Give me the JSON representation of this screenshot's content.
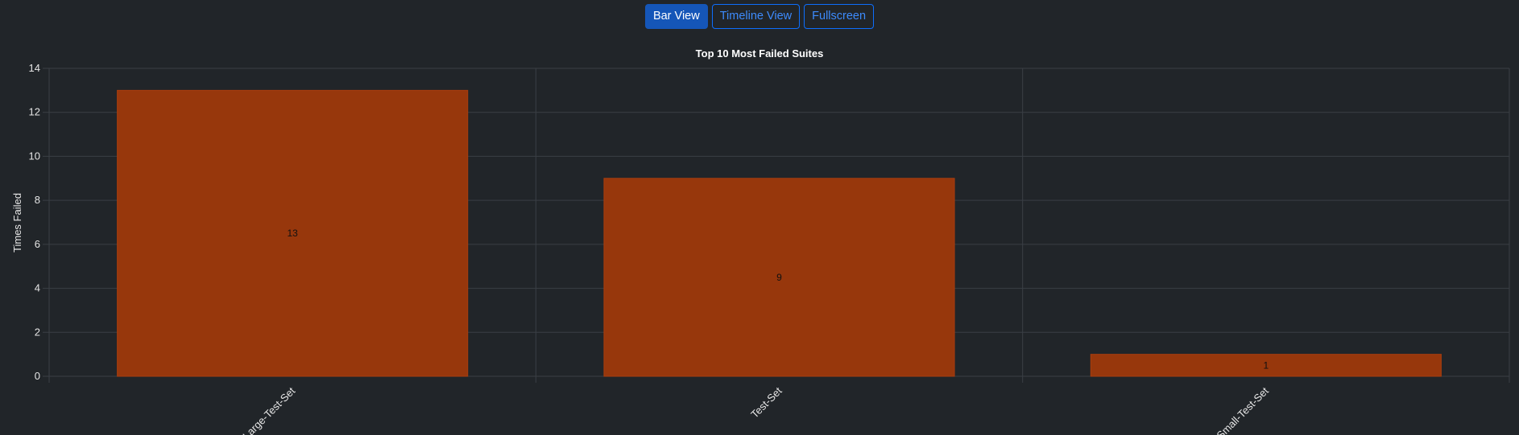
{
  "toolbar": {
    "buttons": [
      {
        "label": "Bar View",
        "active": true
      },
      {
        "label": "Timeline View",
        "active": false
      },
      {
        "label": "Fullscreen",
        "active": false
      }
    ]
  },
  "colors": {
    "background": "#212529",
    "bar": "#97370c",
    "bar_border": "#a83d0e",
    "grid": "#3a3f45",
    "accent": "#0d6efd"
  },
  "chart_data": {
    "type": "bar",
    "title": "Top 10 Most Failed Suites",
    "xlabel": "",
    "ylabel": "Times Failed",
    "categories": [
      "Large-Test-Set",
      "Test-Set",
      "Small-Test-Set"
    ],
    "values": [
      13,
      9,
      1
    ],
    "ylim": [
      0,
      14
    ],
    "yticks": [
      0,
      2,
      4,
      6,
      8,
      10,
      12,
      14
    ],
    "grid": true,
    "legend": "none",
    "data_labels": true
  }
}
